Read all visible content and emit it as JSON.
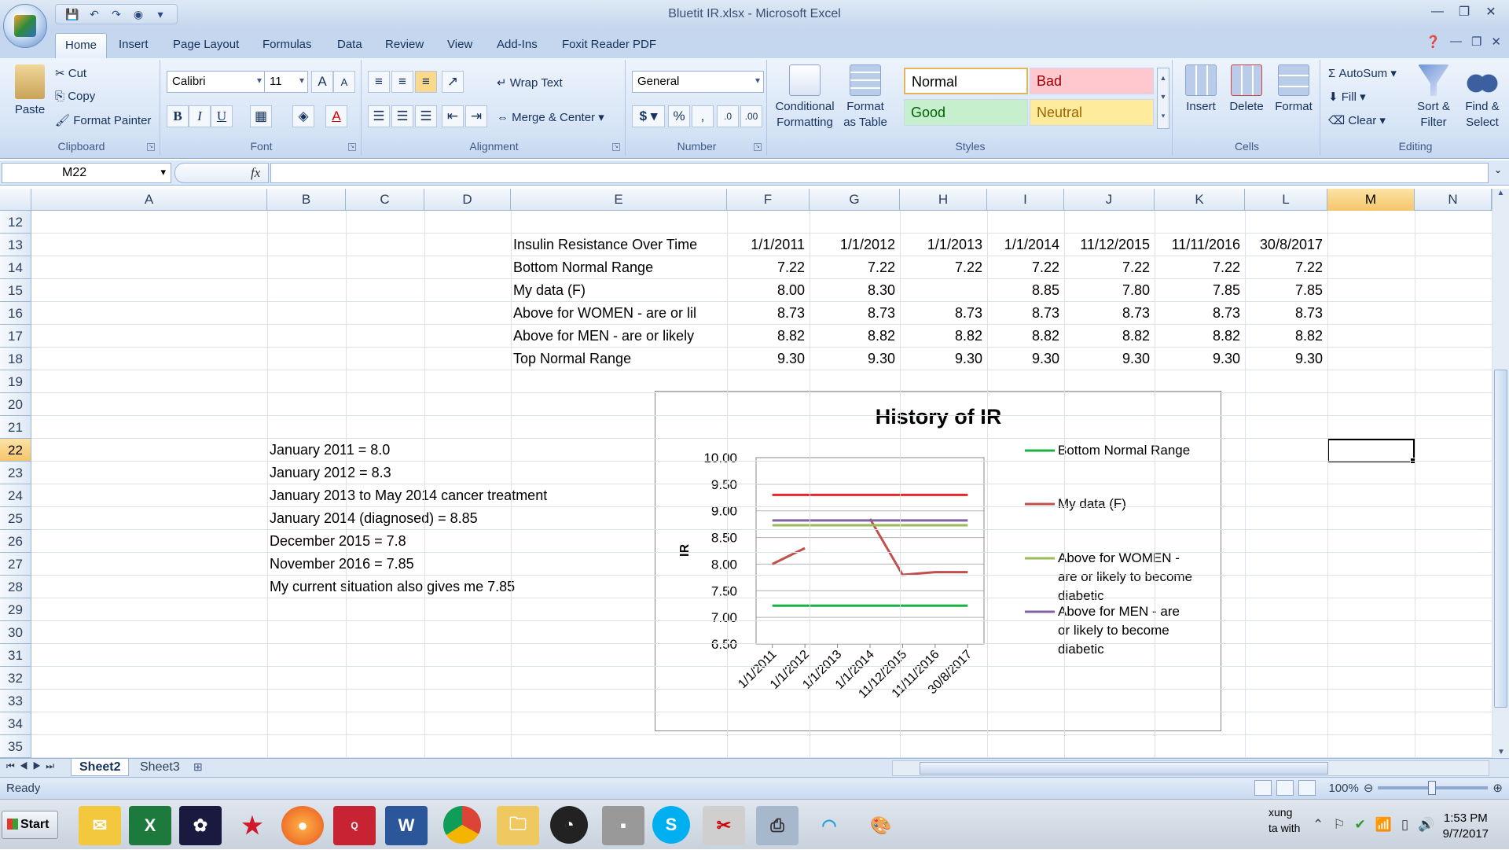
{
  "window": {
    "title": "Bluetit IR.xlsx - Microsoft Excel"
  },
  "ribbon_tabs": [
    "Home",
    "Insert",
    "Page Layout",
    "Formulas",
    "Data",
    "Review",
    "View",
    "Add-Ins",
    "Foxit Reader PDF"
  ],
  "clipboard": {
    "paste": "Paste",
    "cut": "Cut",
    "copy": "Copy",
    "format_painter": "Format Painter",
    "label": "Clipboard"
  },
  "font": {
    "name": "Calibri",
    "size": "11",
    "label": "Font"
  },
  "alignment": {
    "wrap": "Wrap Text",
    "merge": "Merge & Center",
    "label": "Alignment"
  },
  "number": {
    "format": "General",
    "label": "Number"
  },
  "styles": {
    "conditional": "Conditional Formatting",
    "format_table": "Format as Table",
    "normal": "Normal",
    "bad": "Bad",
    "good": "Good",
    "neutral": "Neutral",
    "label": "Styles"
  },
  "cells_group": {
    "insert": "Insert",
    "delete": "Delete",
    "format": "Format",
    "label": "Cells"
  },
  "editing": {
    "autosum": "AutoSum",
    "fill": "Fill",
    "clear": "Clear",
    "sort": "Sort & Filter",
    "find": "Find & Select",
    "label": "Editing"
  },
  "formula_bar": {
    "name_box": "M22",
    "fx": "fx",
    "formula": ""
  },
  "columns": [
    "A",
    "B",
    "C",
    "D",
    "E",
    "F",
    "G",
    "H",
    "I",
    "J",
    "K",
    "L",
    "M",
    "N"
  ],
  "rows": [
    "12",
    "13",
    "14",
    "15",
    "16",
    "17",
    "18",
    "19",
    "20",
    "21",
    "22",
    "23",
    "24",
    "25",
    "26",
    "27",
    "28",
    "29",
    "30",
    "31",
    "32",
    "33",
    "34",
    "35"
  ],
  "table": {
    "header": [
      "Insulin Resistance Over Time",
      "1/1/2011",
      "1/1/2012",
      "1/1/2013",
      "1/1/2014",
      "11/12/2015",
      "11/11/2016",
      "30/8/2017"
    ],
    "rows": [
      [
        "Bottom  Normal Range",
        "7.22",
        "7.22",
        "7.22",
        "7.22",
        "7.22",
        "7.22",
        "7.22"
      ],
      [
        "My data (F)",
        "8.00",
        "8.30",
        "",
        "8.85",
        "7.80",
        "7.85",
        "7.85"
      ],
      [
        "Above for WOMEN  - are or lil",
        "8.73",
        "8.73",
        "8.73",
        "8.73",
        "8.73",
        "8.73",
        "8.73"
      ],
      [
        "Above for MEN  - are or likely",
        "8.82",
        "8.82",
        "8.82",
        "8.82",
        "8.82",
        "8.82",
        "8.82"
      ],
      [
        "Top Normal Range",
        "9.30",
        "9.30",
        "9.30",
        "9.30",
        "9.30",
        "9.30",
        "9.30"
      ]
    ]
  },
  "notes": [
    "January 2011 = 8.0",
    "January 2012 = 8.3",
    "January 2013 to May 2014 cancer treatment",
    "January 2014 (diagnosed) = 8.85",
    "December 2015 = 7.8",
    "November 2016 = 7.85",
    "My current situation also gives me 7.85"
  ],
  "chart_data": {
    "type": "line",
    "title": "History of IR",
    "ylabel": "IR",
    "xlabel": "",
    "ylim": [
      6.5,
      10.0
    ],
    "yticks": [
      "10.00",
      "9.50",
      "9.00",
      "8.50",
      "8.00",
      "7.50",
      "7.00",
      "6.50"
    ],
    "categories": [
      "1/1/2011",
      "1/1/2012",
      "1/1/2013",
      "1/1/2014",
      "11/12/2015",
      "11/11/2016",
      "30/8/2017"
    ],
    "legend_position": "right",
    "series": [
      {
        "name": "Bottom  Normal Range",
        "color": "#1db045",
        "values": [
          7.22,
          7.22,
          7.22,
          7.22,
          7.22,
          7.22,
          7.22
        ]
      },
      {
        "name": "My data (F)",
        "color": "#c0504d",
        "values": [
          8.0,
          8.3,
          null,
          8.85,
          7.8,
          7.85,
          7.85
        ]
      },
      {
        "name": "Above for WOMEN  - are or likely to become diabetic",
        "color": "#9bbb59",
        "values": [
          8.73,
          8.73,
          8.73,
          8.73,
          8.73,
          8.73,
          8.73
        ]
      },
      {
        "name": "Above for MEN  - are or likely to become diabetic",
        "color": "#8064a2",
        "values": [
          8.82,
          8.82,
          8.82,
          8.82,
          8.82,
          8.82,
          8.82
        ]
      },
      {
        "name": "Top Normal Range",
        "color": "#e8262a",
        "values": [
          9.3,
          9.3,
          9.3,
          9.3,
          9.3,
          9.3,
          9.3
        ],
        "in_legend": false
      }
    ]
  },
  "legend_lines": [
    [
      "Bottom  Normal Range"
    ],
    [
      "My data (F)"
    ],
    [
      "Above for WOMEN  -",
      "are or likely to become",
      "diabetic"
    ],
    [
      "Above for MEN  - are",
      "or likely to become",
      "diabetic"
    ]
  ],
  "sheets": [
    "Sheet2",
    "Sheet3"
  ],
  "status": {
    "ready": "Ready",
    "zoom": "100%"
  },
  "taskbar": {
    "start": "Start",
    "tray_text_1": "xung",
    "tray_text_2": "ta with",
    "time": "1:53 PM",
    "date": "9/7/2017"
  }
}
